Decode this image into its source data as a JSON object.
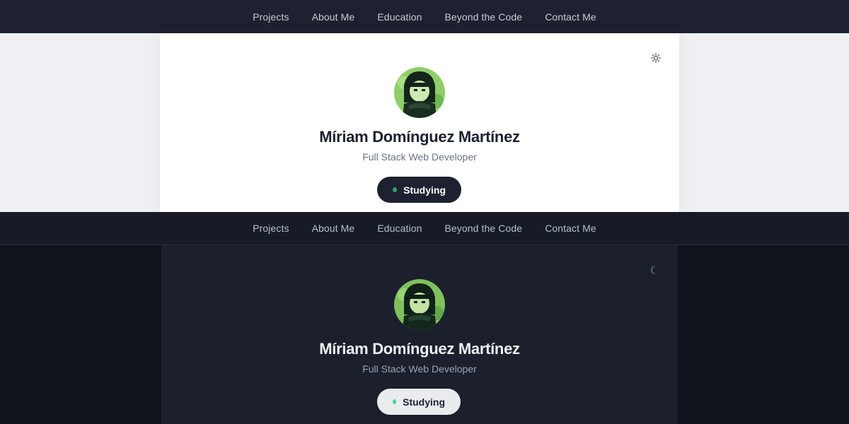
{
  "nav": {
    "items": [
      {
        "label": "Projects"
      },
      {
        "label": "About Me"
      },
      {
        "label": "Education"
      },
      {
        "label": "Beyond the Code"
      },
      {
        "label": "Contact Me"
      }
    ]
  },
  "profile": {
    "name": "Míriam Domínguez Martínez",
    "role": "Full Stack Web Developer",
    "status": "Studying",
    "avatar_icon": "avatar-illustration"
  },
  "themes": {
    "light": {
      "toggle_icon": "sun-icon",
      "status_dot_color": "#34a468"
    },
    "dark": {
      "toggle_icon": "moon-icon",
      "status_dot_color": "#4fcf8a"
    }
  }
}
